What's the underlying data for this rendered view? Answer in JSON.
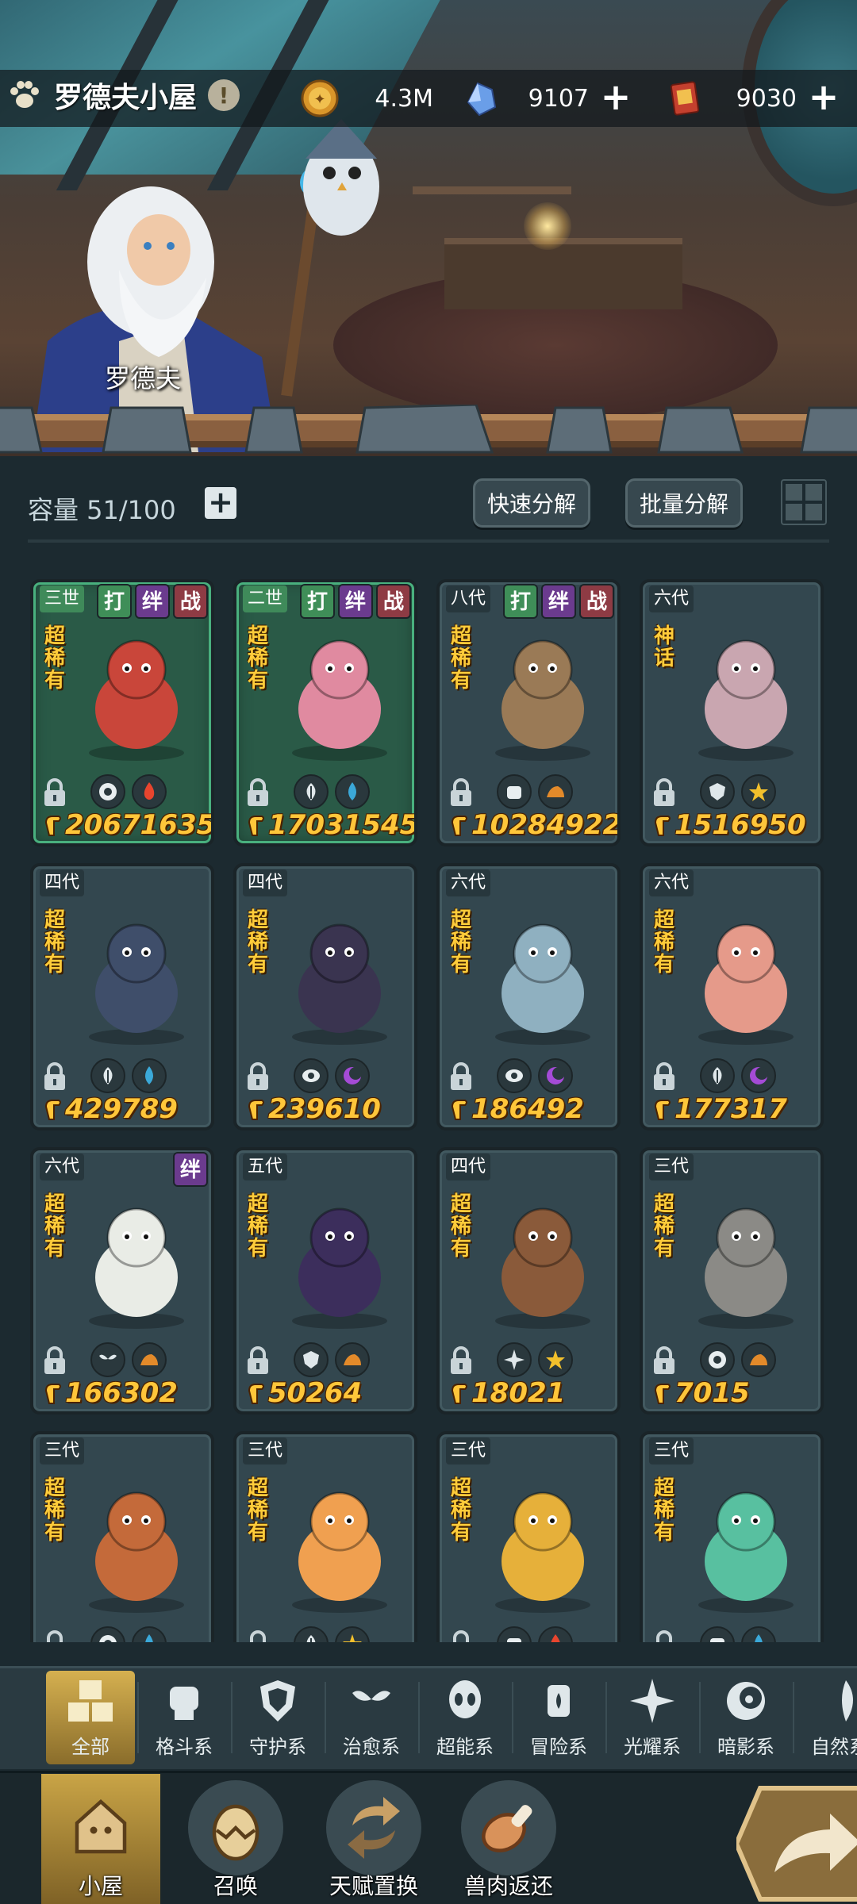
{
  "header": {
    "title": "罗德夫小屋",
    "npc_name": "罗德夫"
  },
  "resources": [
    {
      "icon": "gold-coin-icon",
      "value": "4.3M"
    },
    {
      "icon": "blue-crystal-icon",
      "value": "9107"
    },
    {
      "icon": "red-ticket-icon",
      "value": "9030"
    }
  ],
  "controls": {
    "capacity": "容量 51/100",
    "quick_decompose": "快速分解",
    "batch_decompose": "批量分解"
  },
  "cards": [
    {
      "gen": "三世",
      "tags": [
        "打",
        "绊",
        "战"
      ],
      "rarity": "超稀有",
      "power": "20671635",
      "attrs": [
        "psychic",
        "fire"
      ],
      "green": true
    },
    {
      "gen": "二世",
      "tags": [
        "打",
        "绊",
        "战"
      ],
      "rarity": "超稀有",
      "power": "17031545",
      "attrs": [
        "leaf",
        "water"
      ],
      "green": true
    },
    {
      "gen": "八代",
      "tags": [
        "打",
        "绊",
        "战"
      ],
      "rarity": "超稀有",
      "power": "10284922",
      "attrs": [
        "fist",
        "rock"
      ],
      "green": false
    },
    {
      "gen": "六代",
      "tags": [],
      "rarity": "神话",
      "power": "1516950",
      "attrs": [
        "guard",
        "light"
      ],
      "green": false
    },
    {
      "gen": "四代",
      "tags": [],
      "rarity": "超稀有",
      "power": "429789",
      "attrs": [
        "leaf",
        "water"
      ],
      "green": false
    },
    {
      "gen": "四代",
      "tags": [],
      "rarity": "超稀有",
      "power": "239610",
      "attrs": [
        "eye",
        "dark"
      ],
      "green": false
    },
    {
      "gen": "六代",
      "tags": [],
      "rarity": "超稀有",
      "power": "186492",
      "attrs": [
        "eye",
        "dark"
      ],
      "green": false
    },
    {
      "gen": "六代",
      "tags": [],
      "rarity": "超稀有",
      "power": "177317",
      "attrs": [
        "leaf",
        "dark"
      ],
      "green": false
    },
    {
      "gen": "六代",
      "tags": [
        "绊"
      ],
      "rarity": "超稀有",
      "power": "166302",
      "attrs": [
        "sprout",
        "rock"
      ],
      "green": false
    },
    {
      "gen": "五代",
      "tags": [],
      "rarity": "超稀有",
      "power": "50264",
      "attrs": [
        "guard",
        "rock"
      ],
      "green": false
    },
    {
      "gen": "四代",
      "tags": [],
      "rarity": "超稀有",
      "power": "18021",
      "attrs": [
        "star",
        "light"
      ],
      "green": false
    },
    {
      "gen": "三代",
      "tags": [],
      "rarity": "超稀有",
      "power": "7015",
      "attrs": [
        "psychic",
        "rock"
      ],
      "green": false
    },
    {
      "gen": "三代",
      "tags": [],
      "rarity": "超稀有",
      "power": "",
      "attrs": [
        "psychic",
        "water"
      ],
      "green": false
    },
    {
      "gen": "三代",
      "tags": [],
      "rarity": "超稀有",
      "power": "",
      "attrs": [
        "leaf",
        "light"
      ],
      "green": false
    },
    {
      "gen": "三代",
      "tags": [],
      "rarity": "超稀有",
      "power": "",
      "attrs": [
        "fist",
        "fire"
      ],
      "green": false
    },
    {
      "gen": "三代",
      "tags": [],
      "rarity": "超稀有",
      "power": "",
      "attrs": [
        "fist",
        "water"
      ],
      "green": false
    }
  ],
  "categories": [
    {
      "label": "全部",
      "icon": "all-blocks-icon",
      "active": true
    },
    {
      "label": "格斗系",
      "icon": "fist-icon",
      "active": false
    },
    {
      "label": "守护系",
      "icon": "shield-icon",
      "active": false
    },
    {
      "label": "治愈系",
      "icon": "sprout-icon",
      "active": false
    },
    {
      "label": "超能系",
      "icon": "alien-icon",
      "active": false
    },
    {
      "label": "冒险系",
      "icon": "lantern-icon",
      "active": false
    },
    {
      "label": "光耀系",
      "icon": "star-compass-icon",
      "active": false
    },
    {
      "label": "暗影系",
      "icon": "crescent-eye-icon",
      "active": false
    },
    {
      "label": "自然系",
      "icon": "nature-icon",
      "active": false
    }
  ],
  "nav": [
    {
      "label": "小屋",
      "icon": "house-icon",
      "active": true
    },
    {
      "label": "召唤",
      "icon": "egg-icon",
      "active": false
    },
    {
      "label": "天赋置换",
      "icon": "swap-icon",
      "active": false
    },
    {
      "label": "兽肉返还",
      "icon": "meat-icon",
      "active": false
    }
  ],
  "colors": {
    "power": "#ffc63a",
    "rarity": "#ffcc3a",
    "active_tab": "#d5b050",
    "panel": "#1c2a30"
  }
}
